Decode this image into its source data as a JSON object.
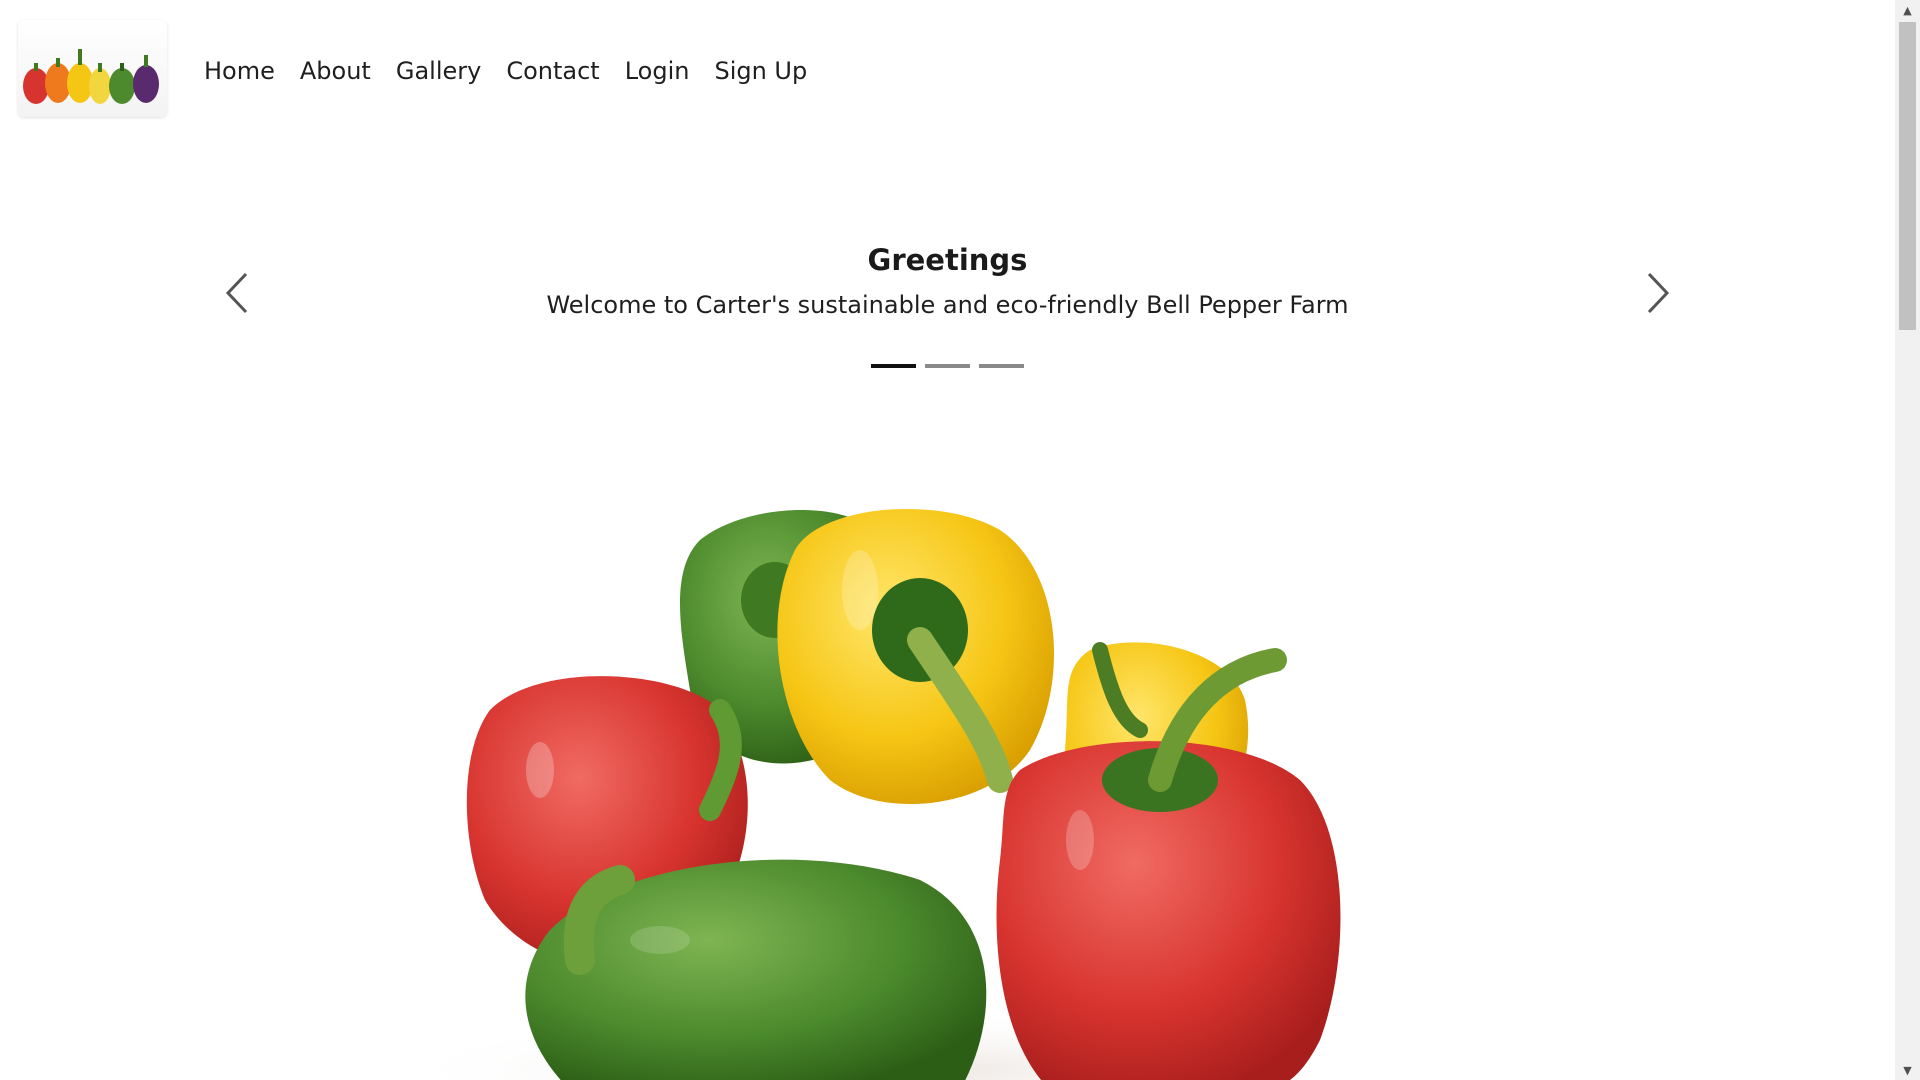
{
  "nav": {
    "links": [
      {
        "label": "Home"
      },
      {
        "label": "About"
      },
      {
        "label": "Gallery"
      },
      {
        "label": "Contact"
      },
      {
        "label": "Login"
      },
      {
        "label": "Sign Up"
      }
    ]
  },
  "carousel": {
    "title": "Greetings",
    "subtitle": "Welcome to Carter's sustainable and eco-friendly Bell Pepper Farm",
    "prev_icon": "chevron-left-icon",
    "next_icon": "chevron-right-icon",
    "slide_count": 3,
    "active_slide": 1
  },
  "colors": {
    "pepper_red": "#d8342f",
    "pepper_yellow": "#f6c615",
    "pepper_green": "#4c8a2d",
    "pepper_purple": "#5a2a6e",
    "indicator_active": "#111111",
    "indicator_inactive": "#8a8a8a"
  }
}
